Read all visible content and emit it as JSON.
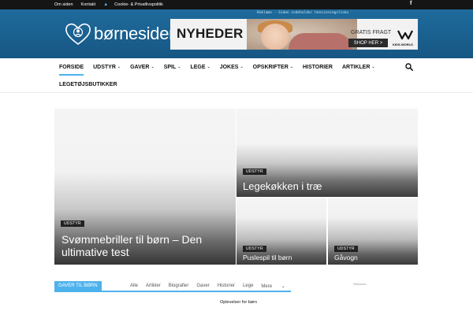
{
  "topbar": {
    "links": [
      "Om siden",
      "Kontakt",
      "Cookie- & Privatlivspolitik"
    ],
    "facebook_icon": "facebook-icon"
  },
  "header": {
    "logo_text": "børnesiden",
    "ad_notice": "Reklame - Siden indeholder henvisningslinks",
    "banner": {
      "headline": "NYHEDER",
      "free_shipping": "GRATIS FRAGT",
      "shop_button": "SHOP HER >",
      "brand": "KIDS-WORLD"
    }
  },
  "nav": {
    "row1": [
      {
        "label": "FORSIDE",
        "has_dropdown": false,
        "active": true
      },
      {
        "label": "UDSTYR",
        "has_dropdown": true
      },
      {
        "label": "GAVER",
        "has_dropdown": true
      },
      {
        "label": "SPIL",
        "has_dropdown": true
      },
      {
        "label": "LEGE",
        "has_dropdown": true
      },
      {
        "label": "JOKES",
        "has_dropdown": true
      },
      {
        "label": "OPSKRIFTER",
        "has_dropdown": true
      },
      {
        "label": "HISTORIER",
        "has_dropdown": false
      },
      {
        "label": "ARTIKLER",
        "has_dropdown": true
      }
    ],
    "row2": [
      {
        "label": "LEGETØJSBUTIKKER",
        "has_dropdown": false
      }
    ],
    "chevron": "⌄"
  },
  "featured": {
    "big": {
      "category": "UDSTYR",
      "title": "Svømmebriller til børn – Den ultimative test"
    },
    "wide": {
      "category": "UDSTYR",
      "title": "Legekøkken i træ"
    },
    "small1": {
      "category": "UDSTYR",
      "title": "Puslespil til børn"
    },
    "small2": {
      "category": "UDSTYR",
      "title": "Gåvogn"
    }
  },
  "block": {
    "title": "GAVER TIL BØRN",
    "filters": [
      "Alle",
      "Artikler",
      "Biografier",
      "Gaver",
      "Historier",
      "Lege"
    ],
    "more": "Mere"
  },
  "reklame": "- Reklame -",
  "subtitle": "Oplevelser for børn",
  "colors": {
    "accent": "#4db2ec",
    "header_blue": "#1e6b9c",
    "topbar": "#151515"
  }
}
